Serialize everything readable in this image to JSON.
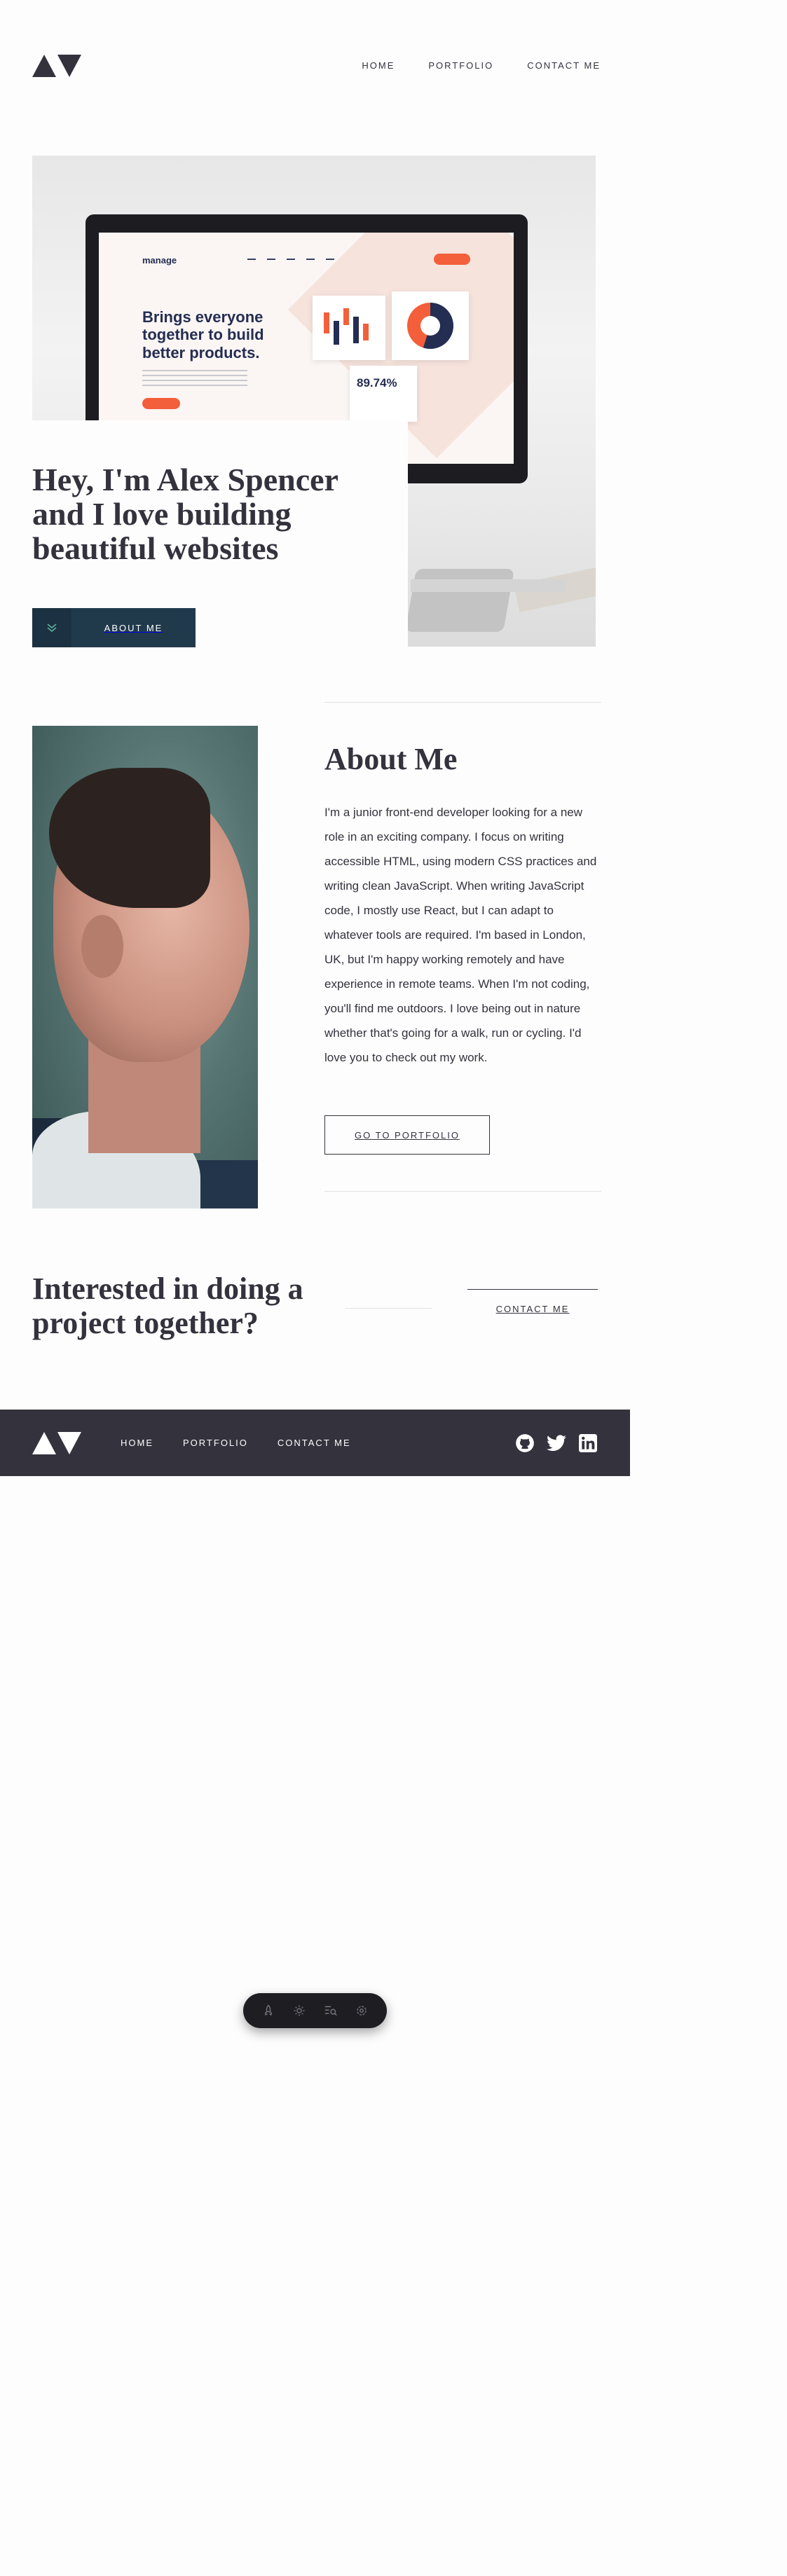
{
  "nav": {
    "home": "HOME",
    "portfolio": "PORTFOLIO",
    "contact": "CONTACT ME"
  },
  "hero": {
    "title": "Hey, I'm Alex Spencer and I love building beautiful websites",
    "button": "ABOUT ME",
    "mockup": {
      "brand": "manage",
      "headline": "Brings everyone together to build better products.",
      "stat": "89.74%"
    }
  },
  "about": {
    "title": "About Me",
    "body": "I'm a junior front-end developer looking for a new role in an exciting company. I focus on writing accessible HTML, using modern CSS practices and writing clean JavaScript. When writing JavaScript code, I mostly use React, but I can adapt to whatever tools are required. I'm based in London, UK, but I'm happy working remotely and have experience in remote teams. When I'm not coding, you'll find me outdoors. I love being out in nature whether that's going for a walk, run or cycling. I'd love you to check out my work.",
    "button": "GO TO PORTFOLIO"
  },
  "cta": {
    "title": "Interested in doing a project together?",
    "button": "CONTACT ME"
  },
  "footer": {
    "home": "HOME",
    "portfolio": "PORTFOLIO",
    "contact": "CONTACT ME",
    "social": [
      "github-icon",
      "twitter-icon",
      "linkedin-icon"
    ]
  },
  "toolbar": {
    "icons": [
      "rocket-icon",
      "settings-icon",
      "list-search-icon",
      "gear-icon"
    ]
  },
  "colors": {
    "dark": "#33323d",
    "navy": "#203a4c",
    "accent": "#f25f3a",
    "background": "#fdfdfd"
  }
}
